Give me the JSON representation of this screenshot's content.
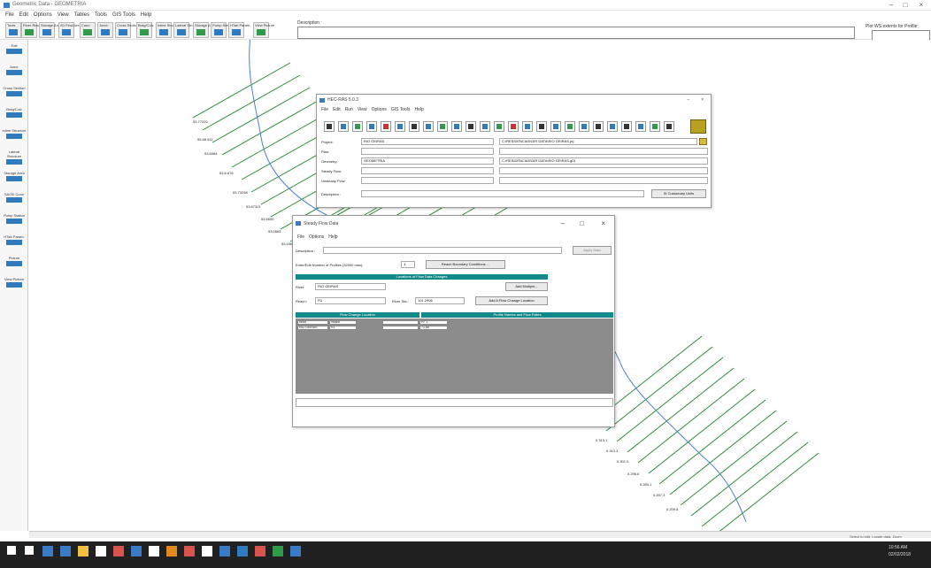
{
  "app": {
    "title": "Geometric Data - GEOMETRIA",
    "menu": [
      "File",
      "Edit",
      "Options",
      "View",
      "Tables",
      "Tools",
      "GIS Tools",
      "Help"
    ],
    "toolbar": [
      {
        "label": "Tools",
        "icon": "tools-icon"
      },
      {
        "label": "River Reach",
        "icon": "river-reach-icon"
      },
      {
        "label": "Storage Area",
        "icon": "storage-area-icon"
      },
      {
        "label": "2D Flow Area",
        "icon": "2d-flow-area-icon"
      },
      {
        "label": "Conn",
        "icon": "connection-icon"
      },
      {
        "label": "Junct.",
        "icon": "junction-icon"
      },
      {
        "label": "Cross Section",
        "icon": "cross-section-icon"
      },
      {
        "label": "Brdg/Culv",
        "icon": "bridge-culvert-icon"
      },
      {
        "label": "Inline Structure",
        "icon": "inline-structure-icon"
      },
      {
        "label": "Lateral Structure",
        "icon": "lateral-structure-icon"
      },
      {
        "label": "Storage Area Conn",
        "icon": "storage-conn-icon"
      },
      {
        "label": "Pump Station",
        "icon": "pump-station-icon"
      },
      {
        "label": "HTab Param.",
        "icon": "htab-icon"
      },
      {
        "label": "View Picture",
        "icon": "picture-icon"
      }
    ],
    "description_label": "Description :",
    "right_label": "Plot WS extents for Profile:",
    "left_tools": [
      {
        "label": "Edit"
      },
      {
        "label": "Junct."
      },
      {
        "label": "Cross Section"
      },
      {
        "label": "Brdg/Culv"
      },
      {
        "label": "Inline Structure"
      },
      {
        "label": "Lateral Structure"
      },
      {
        "label": "Storage Area"
      },
      {
        "label": "SA/2D Conn"
      },
      {
        "label": "Pump Station"
      },
      {
        "label": "HTab Param."
      },
      {
        "label": "Picture"
      },
      {
        "label": "View Picture"
      }
    ],
    "status_text": "Select to edit, Locate data, Zoom"
  },
  "hecras": {
    "title": "HEC-RAS 5.0.3",
    "menu": [
      "File",
      "Edit",
      "Run",
      "View",
      "Options",
      "GIS Tools",
      "Help"
    ],
    "labels": {
      "project": "Project:",
      "plan": "Plan:",
      "geometry": "Geometry:",
      "steady_flow": "Steady Flow:",
      "unsteady_flow": "Unsteady Flow:",
      "description": "Description :"
    },
    "values": {
      "project": "RIO GEIRAS",
      "project_path": "C:\\RESIDENCIAS\\DIR DATA\\RIO GEIRAS.prj",
      "geometry": "GEOMETRIA",
      "geometry_path": "C:\\RESIDENCIAS\\DIR DATA\\RIO GEIRAS.g01"
    },
    "si_units_button": "SI Customary Units"
  },
  "steady": {
    "title": "Steady Flow Data",
    "menu": [
      "File",
      "Options",
      "Help"
    ],
    "description_label": "Description :",
    "apply_button": "Apply Data",
    "profiles_label": "Enter/Edit Number of Profiles (32000 max):",
    "profiles_value": "1",
    "reach_boundary_button": "Reach Boundary Conditions ...",
    "locations_bar": "Locations of Flow Data Changes",
    "river_label": "River:",
    "river_value": "RIO GEIRAS",
    "reach_label": "Reach:",
    "reach_value": "R1",
    "river_sta_label": "River Sta.:",
    "river_sta_value": "101.2906",
    "add_multiple_button": "Add Multiple...",
    "add_flow_button": "Add A Flow Change Location",
    "flow_change_bar": "Flow Change Location",
    "profile_bar": "Profile Names and Flow Rates",
    "table_headers": [
      "River",
      "Reach",
      "RS",
      "PF 1"
    ],
    "table_row": [
      "RIO GEIRAS",
      "R1",
      "101.2906",
      "71.85"
    ]
  },
  "xs_labels_upper": [
    "53.77220",
    "55.68.911",
    "53.6084",
    "53.6.676",
    "53.73298",
    "53.67321",
    "53.5600",
    "53.0505",
    "53.1064",
    "52.9706"
  ],
  "xs_labels_lower": [
    "0.313.1",
    "0.313.3",
    "0.301.0",
    "0.298.6",
    "0.283.1",
    "0.267.3",
    "0.209.8"
  ],
  "taskbar_clock": {
    "time": "10:56 AM",
    "date": "02/02/2018"
  }
}
